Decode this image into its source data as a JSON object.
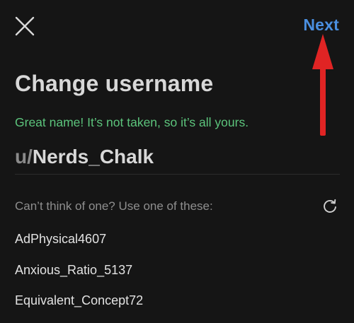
{
  "header": {
    "close_icon": "close-icon",
    "next_label": "Next"
  },
  "page": {
    "title": "Change username",
    "status": "Great name! It’s not taken, so it’s all yours."
  },
  "username": {
    "prefix": "u/",
    "value": "Nerds_Chalk"
  },
  "suggestions": {
    "label": "Can’t think of one? Use one of these:",
    "refresh_icon": "refresh-icon",
    "items": [
      "AdPhysical4607",
      "Anxious_Ratio_5137",
      "Equivalent_Concept72"
    ]
  },
  "colors": {
    "background": "#151515",
    "accent": "#4a8fe0",
    "success": "#5cc47c",
    "annotation_arrow": "#e02424"
  }
}
